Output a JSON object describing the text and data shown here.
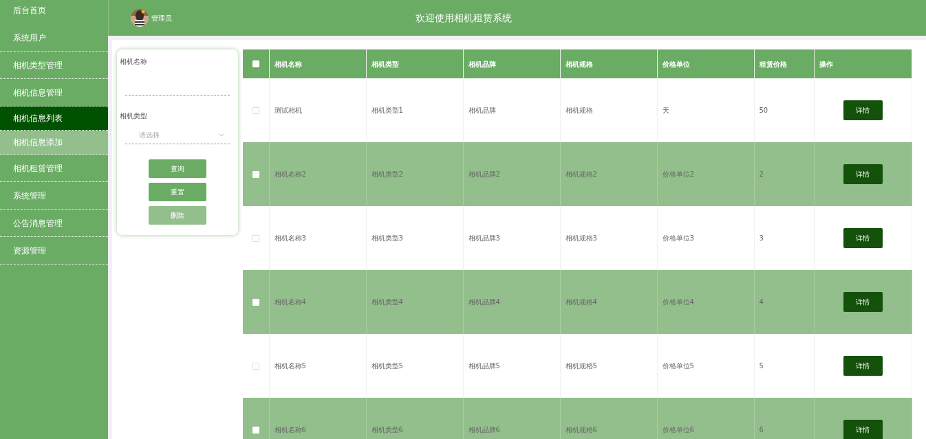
{
  "sidebar": {
    "items": [
      {
        "label": "后台首页",
        "selected": false,
        "hovered": false
      },
      {
        "label": "系统用户",
        "selected": false,
        "hovered": false
      },
      {
        "label": "相机类型管理",
        "selected": false,
        "hovered": false
      },
      {
        "label": "相机信息管理",
        "selected": false,
        "hovered": false
      },
      {
        "label": "相机信息列表",
        "selected": true,
        "hovered": false
      },
      {
        "label": "相机信息添加",
        "selected": false,
        "hovered": true
      },
      {
        "label": "相机租赁管理",
        "selected": false,
        "hovered": false
      },
      {
        "label": "系统管理",
        "selected": false,
        "hovered": false
      },
      {
        "label": "公告消息管理",
        "selected": false,
        "hovered": false
      },
      {
        "label": "资源管理",
        "selected": false,
        "hovered": false
      }
    ]
  },
  "header": {
    "user": "管理员",
    "title": "欢迎使用相机租赁系统"
  },
  "filter": {
    "fields": [
      {
        "kind": "text",
        "label": "相机名称"
      },
      {
        "kind": "select",
        "label": "相机类型",
        "placeholder": "请选择"
      }
    ],
    "buttons": [
      {
        "label": "查询",
        "disabled": false
      },
      {
        "label": "重置",
        "disabled": false
      },
      {
        "label": "删除",
        "disabled": true
      }
    ]
  },
  "table": {
    "select_all": {
      "checked": false
    },
    "columns": [
      "相机名称",
      "相机类型",
      "相机品牌",
      "相机规格",
      "价格单位",
      "租赁价格",
      "操作"
    ],
    "rows": [
      {
        "checked": false,
        "cells": [
          "测试相机",
          "相机类型1",
          "相机品牌",
          "相机规格",
          "天",
          "50"
        ],
        "action": "详情"
      },
      {
        "checked": false,
        "cells": [
          "相机名称2",
          "相机类型2",
          "相机品牌2",
          "相机规格2",
          "价格单位2",
          "2"
        ],
        "action": "详情"
      },
      {
        "checked": false,
        "cells": [
          "相机名称3",
          "相机类型3",
          "相机品牌3",
          "相机规格3",
          "价格单位3",
          "3"
        ],
        "action": "详情"
      },
      {
        "checked": false,
        "cells": [
          "相机名称4",
          "相机类型4",
          "相机品牌4",
          "相机规格4",
          "价格单位4",
          "4"
        ],
        "action": "详情"
      },
      {
        "checked": false,
        "cells": [
          "相机名称5",
          "相机类型5",
          "相机品牌5",
          "相机规格5",
          "价格单位5",
          "5"
        ],
        "action": "详情"
      },
      {
        "checked": false,
        "cells": [
          "相机名称6",
          "相机类型6",
          "相机品牌6",
          "相机规格6",
          "价格单位6",
          "6"
        ],
        "action": "详情"
      }
    ]
  }
}
